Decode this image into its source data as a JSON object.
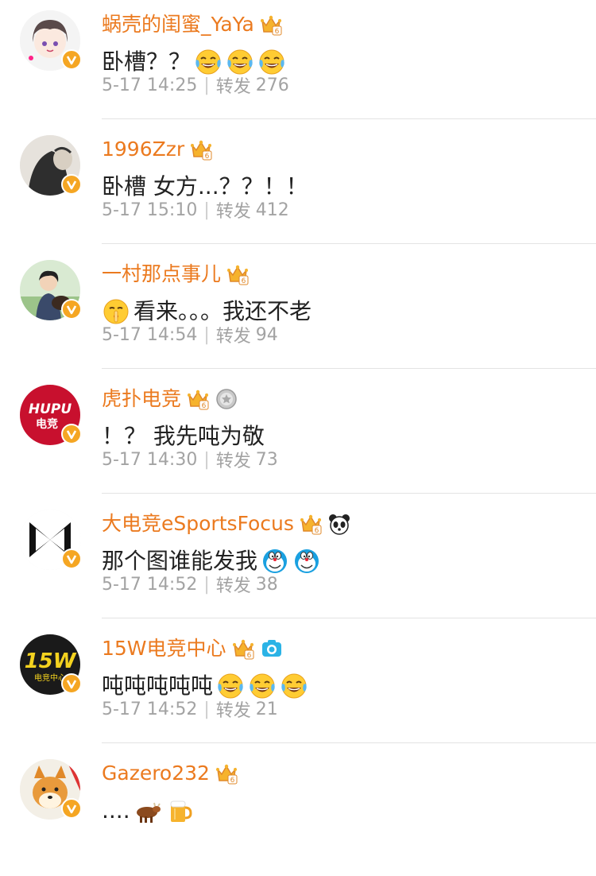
{
  "colors": {
    "name": "#eb7a1f",
    "text": "#222222",
    "meta": "#a3a3a3",
    "divider": "#e3e3e3",
    "v_badge": "#f5a623"
  },
  "repost_label": "转发",
  "comments": [
    {
      "username": "蜗壳的闺蜜_YaYa",
      "badges": [
        "vip-crown-icon"
      ],
      "text": "卧槽？？",
      "emojis": [
        "laughing-crying-emoji",
        "laughing-crying-emoji",
        "laughing-crying-emoji"
      ],
      "time": "5-17 14:25",
      "repost_count": "276",
      "avatar": "anime-girl-avatar"
    },
    {
      "username": "1996Zzr",
      "badges": [
        "vip-crown-icon"
      ],
      "text": "卧槽 女方...？？！！",
      "emojis": [],
      "time": "5-17 15:10",
      "repost_count": "412",
      "avatar": "dark-figure-avatar"
    },
    {
      "username": "一村那点事儿",
      "badges": [
        "vip-crown-icon"
      ],
      "leading_emoji": "shush-face-emoji",
      "text": "看来。。。我还不老",
      "emojis": [],
      "time": "5-17 14:54",
      "repost_count": "94",
      "avatar": "person-with-dog-avatar"
    },
    {
      "username": "虎扑电竞",
      "badges": [
        "vip-crown-icon",
        "medal-icon"
      ],
      "text": "！？ 我先吨为敬",
      "emojis": [],
      "time": "5-17 14:30",
      "repost_count": "73",
      "avatar": "hupu-esports-logo",
      "avatar_text": [
        "HUPU",
        "电竞"
      ]
    },
    {
      "username": "大电竞eSportsFocus",
      "badges": [
        "vip-crown-icon",
        "panda-icon"
      ],
      "text": "那个图谁能发我",
      "emojis": [
        "doraemon-emoji",
        "doraemon-emoji"
      ],
      "time": "5-17 14:52",
      "repost_count": "38",
      "avatar": "bowtie-logo-avatar"
    },
    {
      "username": "15W电竞中心",
      "badges": [
        "vip-crown-icon",
        "camera-icon"
      ],
      "text": "吨吨吨吨吨",
      "emojis": [
        "laughing-crying-emoji",
        "laughing-crying-emoji",
        "laughing-crying-emoji"
      ],
      "time": "5-17 14:52",
      "repost_count": "21",
      "avatar": "15w-logo-avatar",
      "avatar_text": [
        "15W",
        "电竞中心"
      ]
    },
    {
      "username": "Gazero232",
      "badges": [
        "vip-crown-icon"
      ],
      "text": "....",
      "emojis": [
        "cow-emoji",
        "beer-emoji"
      ],
      "time": "",
      "repost_count": "",
      "avatar": "shiba-dog-avatar"
    }
  ]
}
